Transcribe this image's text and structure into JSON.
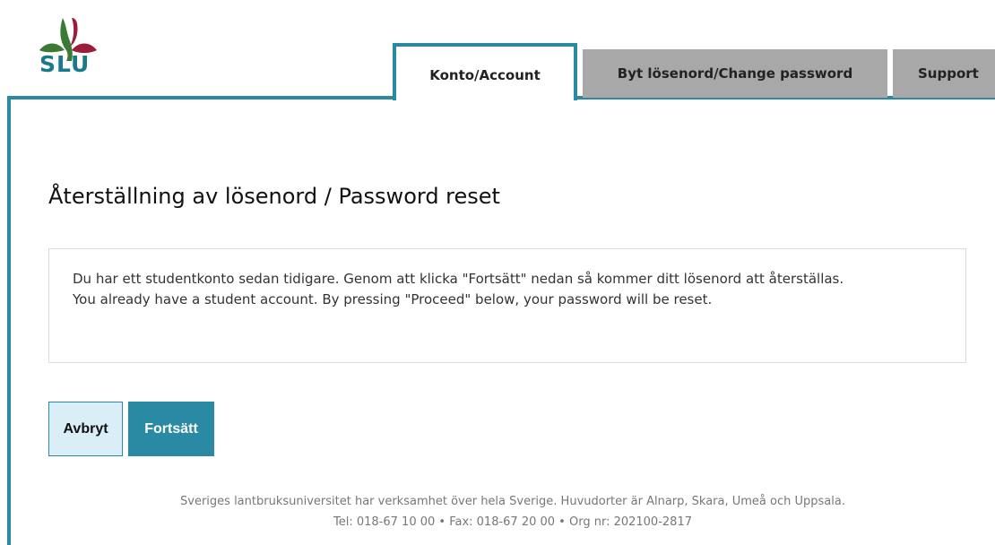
{
  "brand": {
    "logo_text": "SLU",
    "colors": {
      "green": "#3a7a32",
      "red": "#9c1d3a",
      "teal": "#1a7a8c"
    }
  },
  "tabs": [
    {
      "label": "Konto/Account",
      "active": true
    },
    {
      "label": "Byt lösenord/Change password",
      "active": false
    },
    {
      "label": "Support",
      "active": false
    }
  ],
  "main": {
    "title": "Återställning av lösenord / Password reset",
    "notice_sv": "Du har ett studentkonto sedan tidigare. Genom att klicka \"Fortsätt\" nedan så kommer ditt lösenord att återställas.",
    "notice_en": "You already have a student account. By pressing \"Proceed\" below, your password will be reset."
  },
  "buttons": {
    "cancel": "Avbryt",
    "proceed": "Fortsätt"
  },
  "footer": {
    "line1": "Sveriges lantbruksuniversitet har verksamhet över hela Sverige. Huvudorter är Alnarp, Skara, Umeå och Uppsala.",
    "line2": "Tel: 018-67 10 00 • Fax: 018-67 20 00 • Org nr: 202100-2817"
  },
  "accent_color": "#2b8aa3"
}
